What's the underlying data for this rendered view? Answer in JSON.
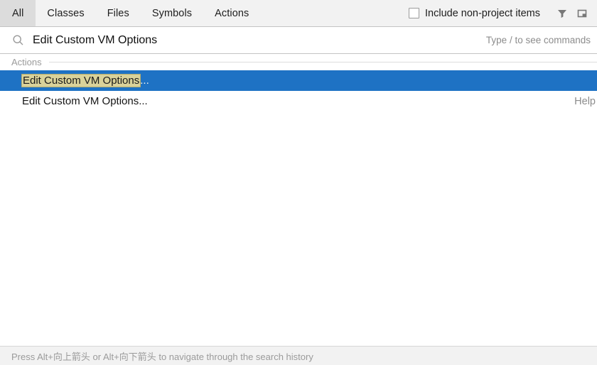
{
  "header": {
    "tabs": [
      {
        "label": "All",
        "selected": true
      },
      {
        "label": "Classes",
        "selected": false
      },
      {
        "label": "Files",
        "selected": false
      },
      {
        "label": "Symbols",
        "selected": false
      },
      {
        "label": "Actions",
        "selected": false
      }
    ],
    "include_non_project": {
      "label": "Include non-project items",
      "checked": false
    },
    "icons": [
      {
        "name": "filter-icon"
      },
      {
        "name": "window-toggle-icon"
      }
    ]
  },
  "search": {
    "icon": "search-icon",
    "value": "Edit Custom VM Options",
    "placeholder": "Type / to see commands",
    "hint": "Type / to see commands"
  },
  "results": {
    "group_label": "Actions",
    "rows": [
      {
        "match": "Edit Custom VM Options",
        "tail": "...",
        "right": "",
        "selected": true
      },
      {
        "match": "",
        "full": "Edit Custom VM Options...",
        "tail": "",
        "right": "Help",
        "selected": false
      }
    ]
  },
  "footer": {
    "text": "Press Alt+向上箭头 or Alt+向下箭头 to navigate through the search history"
  },
  "colors": {
    "selection_blue": "#1e72c4",
    "highlight_khaki": "#d9d29a",
    "header_bg": "#f2f2f2",
    "tab_selected_bg": "#dcdcdc",
    "muted_text": "#9b9b9b",
    "border": "#c4c4c4"
  }
}
